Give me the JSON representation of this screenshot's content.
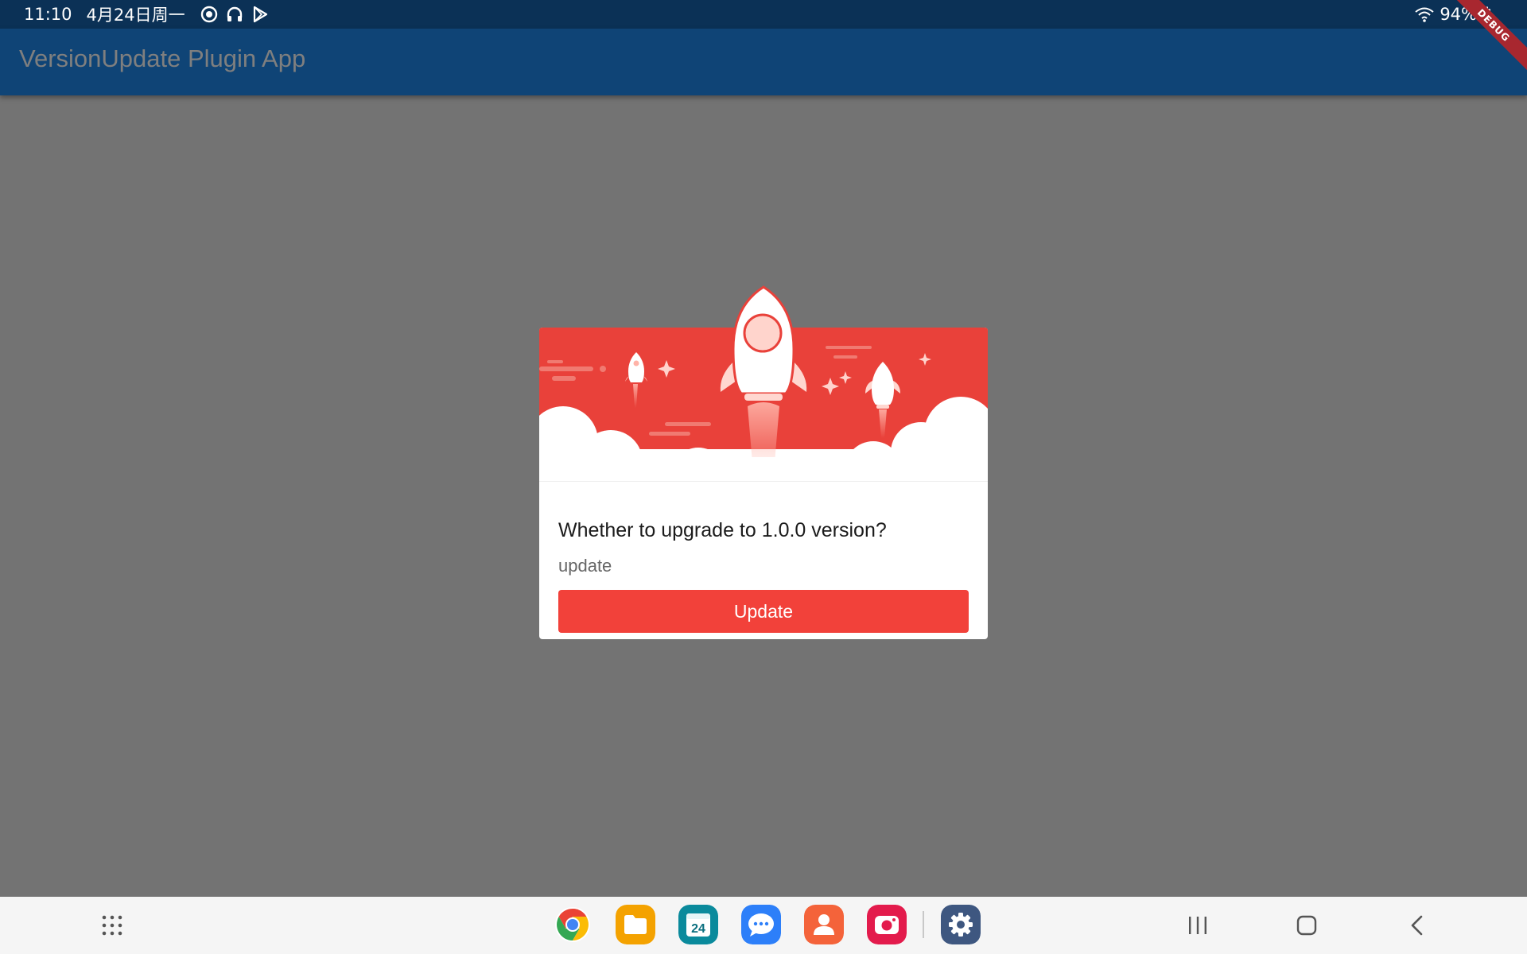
{
  "status_bar": {
    "time": "11:10",
    "date": "4月24日周一",
    "battery": "94%",
    "icons": [
      "sync-icon",
      "headphones-icon",
      "play-store-icon"
    ],
    "right_icons": [
      "wifi-icon",
      "battery-icon"
    ]
  },
  "app_bar": {
    "title": "VersionUpdate Plugin App"
  },
  "debug_banner": "DEBUG",
  "dialog": {
    "title": "Whether to upgrade to 1.0.0 version?",
    "message": "update",
    "button_label": "Update",
    "accent": "#f2413a"
  },
  "dock": {
    "apps": [
      "chrome-icon",
      "files-icon",
      "calendar-icon",
      "messages-icon",
      "contacts-icon",
      "camera-icon",
      "settings-icon"
    ],
    "calendar_day": "24"
  },
  "nav": [
    "apps-grid-icon",
    "recents-icon",
    "home-icon",
    "back-icon"
  ]
}
